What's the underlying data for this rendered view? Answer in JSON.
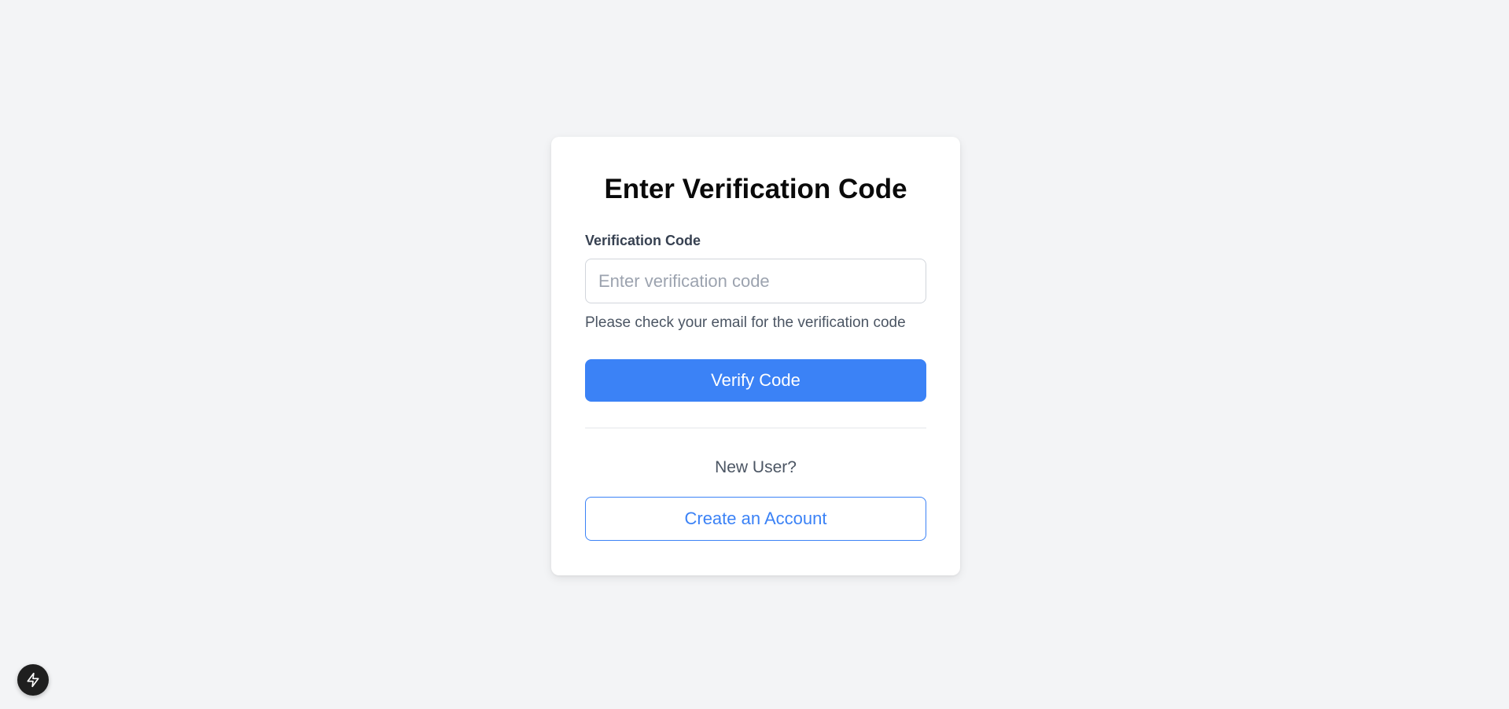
{
  "page": {
    "background_color": "#f3f4f6"
  },
  "card": {
    "title": "Enter Verification Code",
    "code_field": {
      "label": "Verification Code",
      "value": "",
      "placeholder": "Enter verification code"
    },
    "helper_text": "Please check your email for the verification code",
    "verify_button_label": "Verify Code",
    "new_user_text": "New User?",
    "create_account_label": "Create an Account"
  },
  "colors": {
    "primary": "#3b82f6",
    "card_bg": "#ffffff",
    "fab_bg": "#1f1f1f"
  },
  "fab": {
    "icon": "lightning-bolt-icon"
  }
}
